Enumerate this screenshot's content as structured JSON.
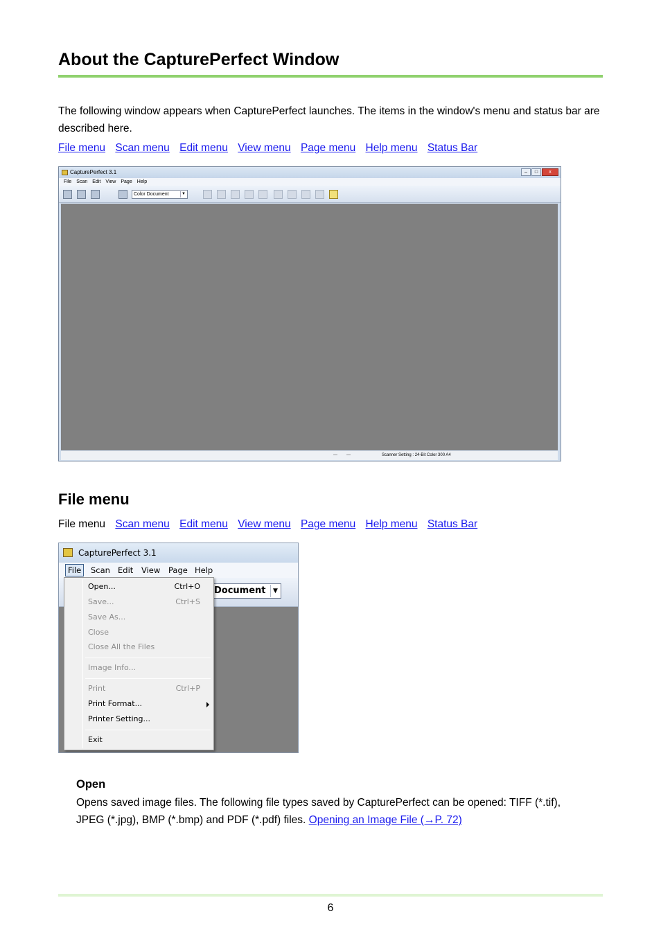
{
  "page": {
    "title": "About the CapturePerfect Window",
    "intro": "The following window appears when CapturePerfect launches. The items in the window's menu and status bar are described here.",
    "links_top": [
      "File menu",
      "Scan menu",
      "Edit menu",
      "View menu",
      "Page menu",
      "Help menu",
      "Status Bar"
    ],
    "section_title": "File menu",
    "links_section": {
      "current": "File menu",
      "items": [
        "Scan menu",
        "Edit menu",
        "View menu",
        "Page menu",
        "Help menu",
        "Status Bar"
      ]
    },
    "open_heading": "Open",
    "open_text_1": "Opens saved image files. The following file types saved by CapturePerfect can be opened: TIFF (*.tif),",
    "open_text_2": "JPEG (*.jpg), BMP (*.bmp) and PDF (*.pdf) files.",
    "open_link": "Opening an Image File (→P. 72) ",
    "page_number": "6",
    "accent_color": "#8fd16e",
    "link_color": "#1a1aee"
  },
  "main_window": {
    "title": "CapturePerfect 3.1",
    "menus": [
      "File",
      "Scan",
      "Edit",
      "View",
      "Page",
      "Help"
    ],
    "document_type": "Color Document",
    "controls": [
      "–",
      "□",
      "x"
    ],
    "status": {
      "field1": "---",
      "field2": "---",
      "scanner_setting": "Scanner Setting : 24-Bit Color 300 A4"
    }
  },
  "file_window": {
    "title": "CapturePerfect 3.1",
    "menus": [
      "File",
      "Scan",
      "Edit",
      "View",
      "Page",
      "Help"
    ],
    "document_type": "Document",
    "menu_items": [
      {
        "label": "Open...",
        "shortcut": "Ctrl+O",
        "enabled": true
      },
      {
        "label": "Save...",
        "shortcut": "Ctrl+S",
        "enabled": false
      },
      {
        "label": "Save As...",
        "shortcut": "",
        "enabled": false
      },
      {
        "label": "Close",
        "shortcut": "",
        "enabled": false
      },
      {
        "label": "Close All the Files",
        "shortcut": "",
        "enabled": false
      },
      {
        "label": "Image Info...",
        "shortcut": "",
        "enabled": false
      },
      {
        "label": "Print",
        "shortcut": "Ctrl+P",
        "enabled": false
      },
      {
        "label": "Print Format...",
        "shortcut": "",
        "enabled": true
      },
      {
        "label": "Printer Setting...",
        "shortcut": "",
        "enabled": true
      },
      {
        "label": "Exit",
        "shortcut": "",
        "enabled": true
      }
    ]
  }
}
